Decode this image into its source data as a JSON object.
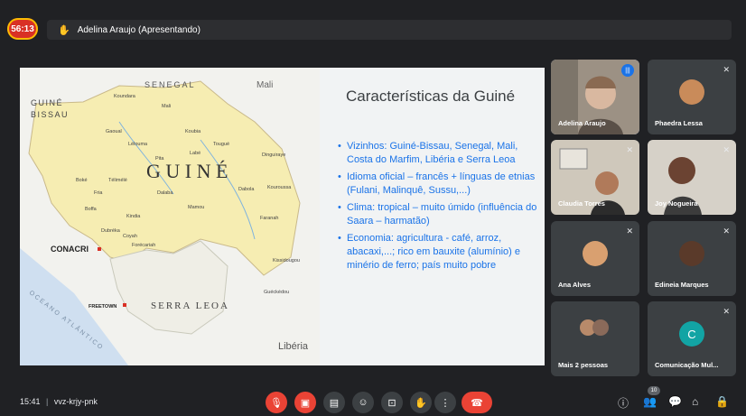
{
  "timer": "56:13",
  "presenting_label": "Adelina Araujo (Apresentando)",
  "slide": {
    "title": "Características da Guiné",
    "bullets": [
      "Vizinhos: Guiné-Bissau, Senegal, Mali, Costa do Marfim, Libéria e Serra Leoa",
      "Idioma oficial – francês + línguas de etnias (Fulani, Malinquê, Sussu,...)",
      "Clima: tropical – muito úmido (influência do Saara – harmatão)",
      "Economia: agricultura - café, arroz, abacaxi,...; rico em bauxite (alumínio) e minério de ferro; país muito pobre"
    ],
    "map": {
      "labels": {
        "senegal": "SENEGAL",
        "mali": "Mali",
        "guine_bissau_1": "GUINÉ",
        "guine_bissau_2": "BISSAU",
        "guine": "G U I N É",
        "conacri": "CONACRI",
        "freetown": "FREETOWN",
        "serra_leoa": "SERRA LEOA",
        "liberia": "Libéria",
        "oceano": "OCEANO ATLÂNTICO"
      },
      "towns": [
        "Koundara",
        "Mali",
        "Gaoual",
        "Koubia",
        "Lélouma",
        "Tougué",
        "Labé",
        "Pita",
        "Dinguiraye",
        "Boké",
        "Télimélé",
        "Dalaba",
        "Dabola",
        "Kouroussa",
        "Fria",
        "Mamou",
        "Boffa",
        "Kindia",
        "Faranah",
        "Dubréka",
        "Coyah",
        "Forécariah",
        "Kissidougou",
        "Guéckédou"
      ]
    }
  },
  "participants": [
    {
      "name": "Adelina Araujo",
      "type": "video",
      "speaking": true
    },
    {
      "name": "Phaedra Lessa",
      "type": "avatar",
      "avatar_color": "#c98b5a"
    },
    {
      "name": "Claudia Torres",
      "type": "video"
    },
    {
      "name": "Joy Nogueira",
      "type": "video"
    },
    {
      "name": "Ana Alves",
      "type": "avatar",
      "avatar_color": "#d9a070"
    },
    {
      "name": "Edineia Marques",
      "type": "avatar",
      "avatar_color": "#5a3a2a"
    },
    {
      "name": "Mais 2 pessoas",
      "type": "more"
    },
    {
      "name": "Comunicação Mul...",
      "type": "letter",
      "letter": "C",
      "avatar_color": "#12a4a4"
    }
  ],
  "bottom": {
    "time": "15:41",
    "meeting_code": "vvz-krjy-pnk",
    "participant_count": "10"
  },
  "colors": {
    "bg": "#202124",
    "tile": "#3c4043",
    "red": "#ea4335",
    "accent_blue": "#1a73e8",
    "map_land": "#f6edb2"
  }
}
